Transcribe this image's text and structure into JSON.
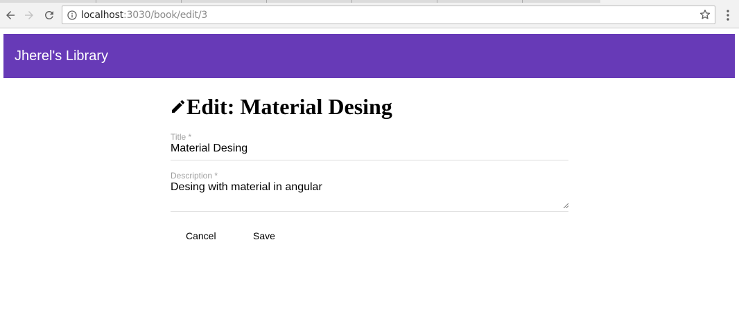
{
  "browser": {
    "url_host": "localhost",
    "url_path": ":3030/book/edit/3",
    "icons": {
      "back": "back-arrow-icon",
      "forward": "forward-arrow-icon",
      "reload": "reload-icon",
      "site_info": "info-icon",
      "bookmark": "star-icon",
      "menu": "kebab-menu-icon"
    }
  },
  "app": {
    "title": "Jherel's Library",
    "accent_color": "#673ab7"
  },
  "page": {
    "heading": "Edit: Material Desing",
    "heading_icon": "pencil-icon"
  },
  "form": {
    "title_field": {
      "label": "Title *",
      "value": "Material Desing"
    },
    "description_field": {
      "label": "Description *",
      "value": "Desing with material in angular"
    },
    "cancel_label": "Cancel",
    "save_label": "Save"
  }
}
